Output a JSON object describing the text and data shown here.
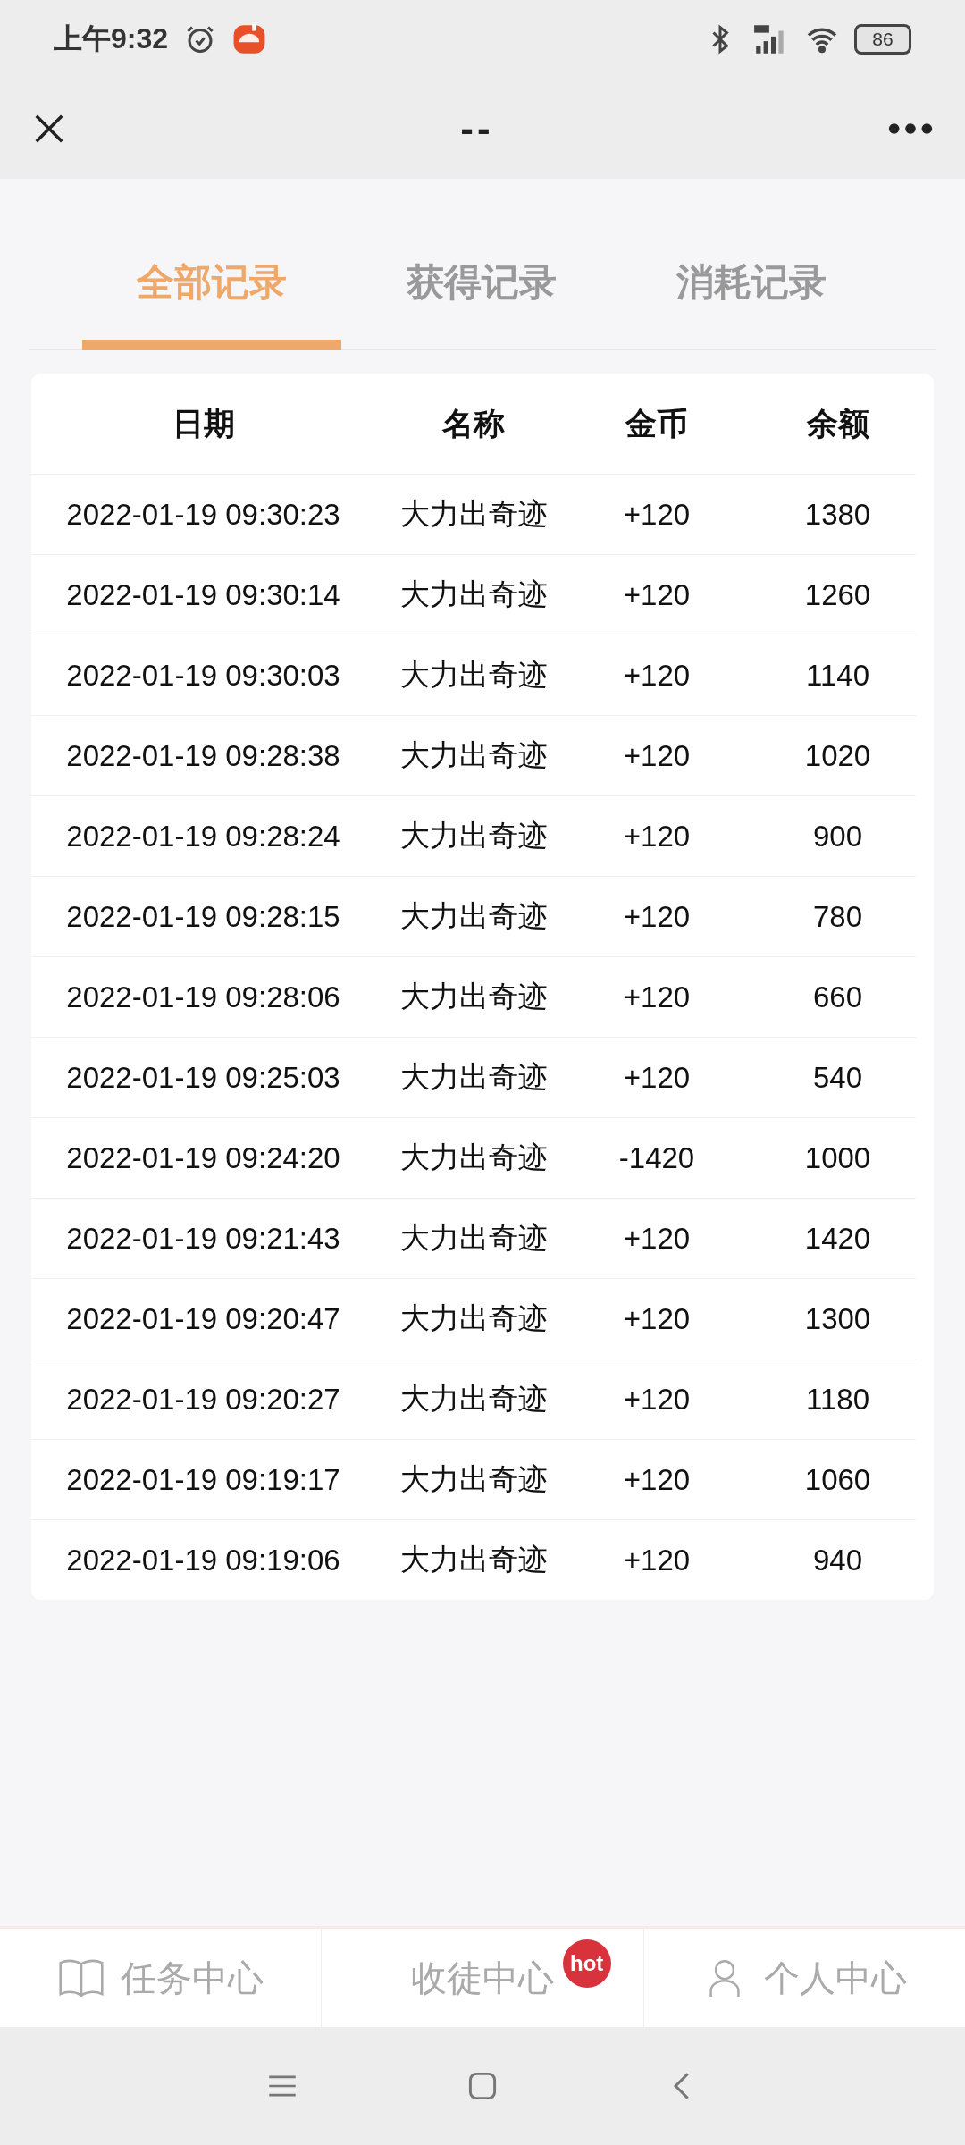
{
  "status_bar": {
    "time": "上午9:32",
    "battery": "86"
  },
  "toolbar": {
    "title": "--"
  },
  "tabs": [
    {
      "label": "全部记录",
      "selected": true
    },
    {
      "label": "获得记录",
      "selected": false
    },
    {
      "label": "消耗记录",
      "selected": false
    }
  ],
  "table": {
    "columns": [
      "日期",
      "名称",
      "金币",
      "余额"
    ],
    "rows": [
      [
        "2022-01-19 09:30:23",
        "大力出奇迹",
        "+120",
        "1380"
      ],
      [
        "2022-01-19 09:30:14",
        "大力出奇迹",
        "+120",
        "1260"
      ],
      [
        "2022-01-19 09:30:03",
        "大力出奇迹",
        "+120",
        "1140"
      ],
      [
        "2022-01-19 09:28:38",
        "大力出奇迹",
        "+120",
        "1020"
      ],
      [
        "2022-01-19 09:28:24",
        "大力出奇迹",
        "+120",
        "900"
      ],
      [
        "2022-01-19 09:28:15",
        "大力出奇迹",
        "+120",
        "780"
      ],
      [
        "2022-01-19 09:28:06",
        "大力出奇迹",
        "+120",
        "660"
      ],
      [
        "2022-01-19 09:25:03",
        "大力出奇迹",
        "+120",
        "540"
      ],
      [
        "2022-01-19 09:24:20",
        "大力出奇迹",
        "-1420",
        "1000"
      ],
      [
        "2022-01-19 09:21:43",
        "大力出奇迹",
        "+120",
        "1420"
      ],
      [
        "2022-01-19 09:20:47",
        "大力出奇迹",
        "+120",
        "1300"
      ],
      [
        "2022-01-19 09:20:27",
        "大力出奇迹",
        "+120",
        "1180"
      ],
      [
        "2022-01-19 09:19:17",
        "大力出奇迹",
        "+120",
        "1060"
      ],
      [
        "2022-01-19 09:19:06",
        "大力出奇迹",
        "+120",
        "940"
      ]
    ]
  },
  "bottom_nav": [
    {
      "label": "任务中心"
    },
    {
      "label": "收徒中心",
      "badge": "hot"
    },
    {
      "label": "个人中心"
    }
  ]
}
